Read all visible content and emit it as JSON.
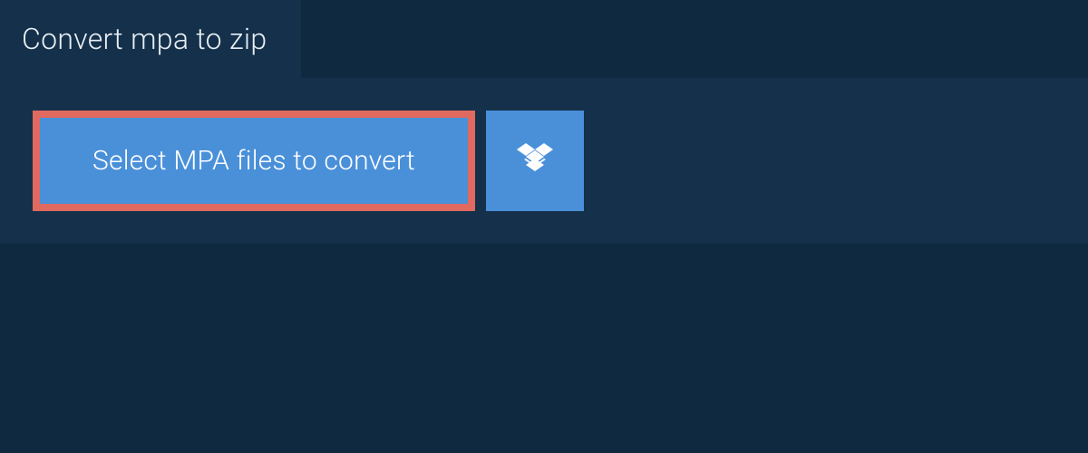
{
  "header": {
    "tab_label": "Convert mpa to zip"
  },
  "main": {
    "select_button_label": "Select MPA files to convert"
  },
  "colors": {
    "background_dark": "#0f2940",
    "panel": "#14304a",
    "button": "#4a90d9",
    "highlight_border": "#e06a5f",
    "text_light": "#e8eef4",
    "text_white": "#ffffff"
  }
}
